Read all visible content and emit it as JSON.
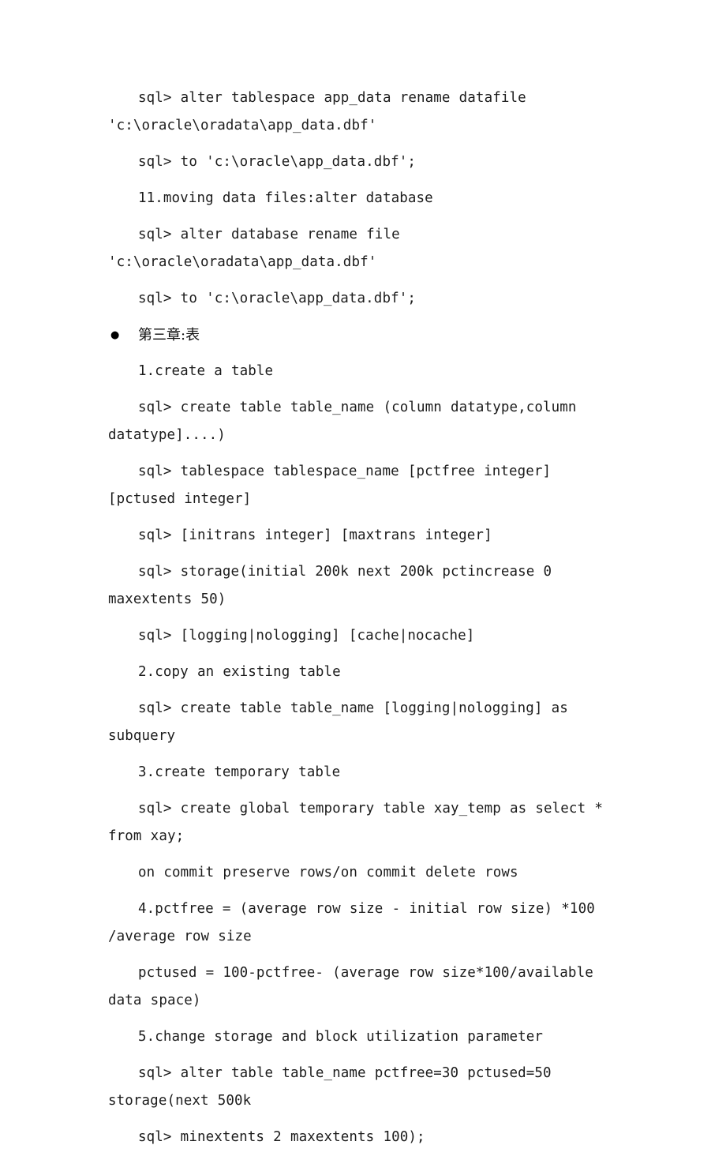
{
  "document": {
    "page_background": "#ffffff",
    "text_color": "#1a1a1a",
    "blocks": [
      {
        "kind": "paragraph",
        "name": "line-alter-tablespace-rename-datafile",
        "text": "sql> alter tablespace app_data rename datafile 'c:\\oracle\\oradata\\app_data.dbf'"
      },
      {
        "kind": "paragraph",
        "name": "line-to-app-data-dbf-1",
        "text": "sql> to 'c:\\oracle\\app_data.dbf';"
      },
      {
        "kind": "paragraph",
        "name": "line-item-11-moving-data-files",
        "text": "11.moving data files:alter database"
      },
      {
        "kind": "paragraph",
        "name": "line-alter-database-rename-file",
        "text": "sql> alter database rename file 'c:\\oracle\\oradata\\app_data.dbf'"
      },
      {
        "kind": "paragraph",
        "name": "line-to-app-data-dbf-2",
        "text": "sql> to 'c:\\oracle\\app_data.dbf';"
      },
      {
        "kind": "bullet",
        "name": "heading-chapter-three-tables",
        "marker": "●",
        "text": "第三章:表"
      },
      {
        "kind": "paragraph",
        "name": "line-item-1-create-a-table",
        "text": "1.create a table"
      },
      {
        "kind": "paragraph",
        "name": "line-create-table-columns",
        "text": "sql> create table table_name (column datatype,column datatype]....)"
      },
      {
        "kind": "paragraph",
        "name": "line-tablespace-pctfree-pctused",
        "text": "sql> tablespace tablespace_name [pctfree integer] [pctused integer]"
      },
      {
        "kind": "paragraph",
        "name": "line-initrans-maxtrans",
        "text": "sql> [initrans integer] [maxtrans integer]"
      },
      {
        "kind": "paragraph",
        "name": "line-storage-initial-next",
        "text": "sql> storage(initial 200k next 200k pctincrease 0 maxextents 50)"
      },
      {
        "kind": "paragraph",
        "name": "line-logging-cache-options",
        "text": "sql> [logging|nologging] [cache|nocache]"
      },
      {
        "kind": "paragraph",
        "name": "line-item-2-copy-existing-table",
        "text": "2.copy an existing table"
      },
      {
        "kind": "paragraph",
        "name": "line-create-table-as-subquery",
        "text": "sql> create table table_name [logging|nologging] as subquery"
      },
      {
        "kind": "paragraph",
        "name": "line-item-3-create-temporary-table",
        "text": "3.create temporary table"
      },
      {
        "kind": "paragraph",
        "name": "line-create-global-temporary-table",
        "text": "sql> create global temporary table xay_temp as select * from xay;"
      },
      {
        "kind": "paragraph",
        "name": "line-on-commit-options",
        "text": "on commit preserve rows/on commit delete rows"
      },
      {
        "kind": "paragraph",
        "name": "line-item-4-pctfree-formula",
        "text": "4.pctfree = (average row size - initial row size) *100 /average row size"
      },
      {
        "kind": "paragraph",
        "name": "line-pctused-formula",
        "text": "pctused = 100-pctfree- (average row size*100/available data space)"
      },
      {
        "kind": "paragraph",
        "name": "line-item-5-change-storage-parameter",
        "text": "5.change storage and block utilization parameter"
      },
      {
        "kind": "paragraph",
        "name": "line-alter-table-pctfree-pctused",
        "text": "sql> alter table table_name pctfree=30 pctused=50 storage(next 500k"
      },
      {
        "kind": "paragraph",
        "name": "line-minextents-maxextents",
        "text": "sql> minextents 2 maxextents 100);"
      }
    ]
  }
}
